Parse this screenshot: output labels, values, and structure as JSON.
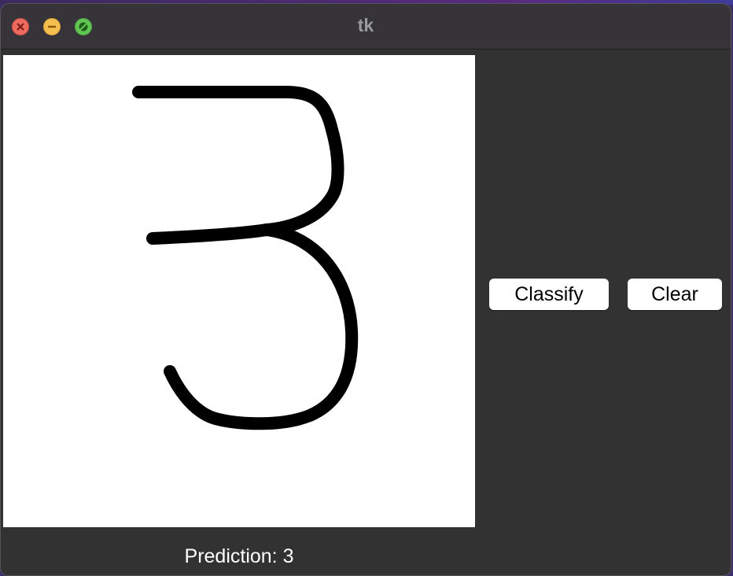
{
  "window": {
    "title": "tk",
    "controls": [
      "close-icon",
      "minimize-icon",
      "maximize-icon"
    ]
  },
  "canvas": {
    "background": "#ffffff",
    "stroke_color": "#000000",
    "drawn_digit_description": "handwritten-3"
  },
  "buttons": {
    "classify_label": "Classify",
    "clear_label": "Clear"
  },
  "result": {
    "prediction_text": "Prediction: 3"
  },
  "colors": {
    "window_bg": "#323232",
    "titlebar_bg": "#363438",
    "close": "#ed6a5e",
    "minimize": "#f5bf4f",
    "maximize": "#61c554"
  }
}
